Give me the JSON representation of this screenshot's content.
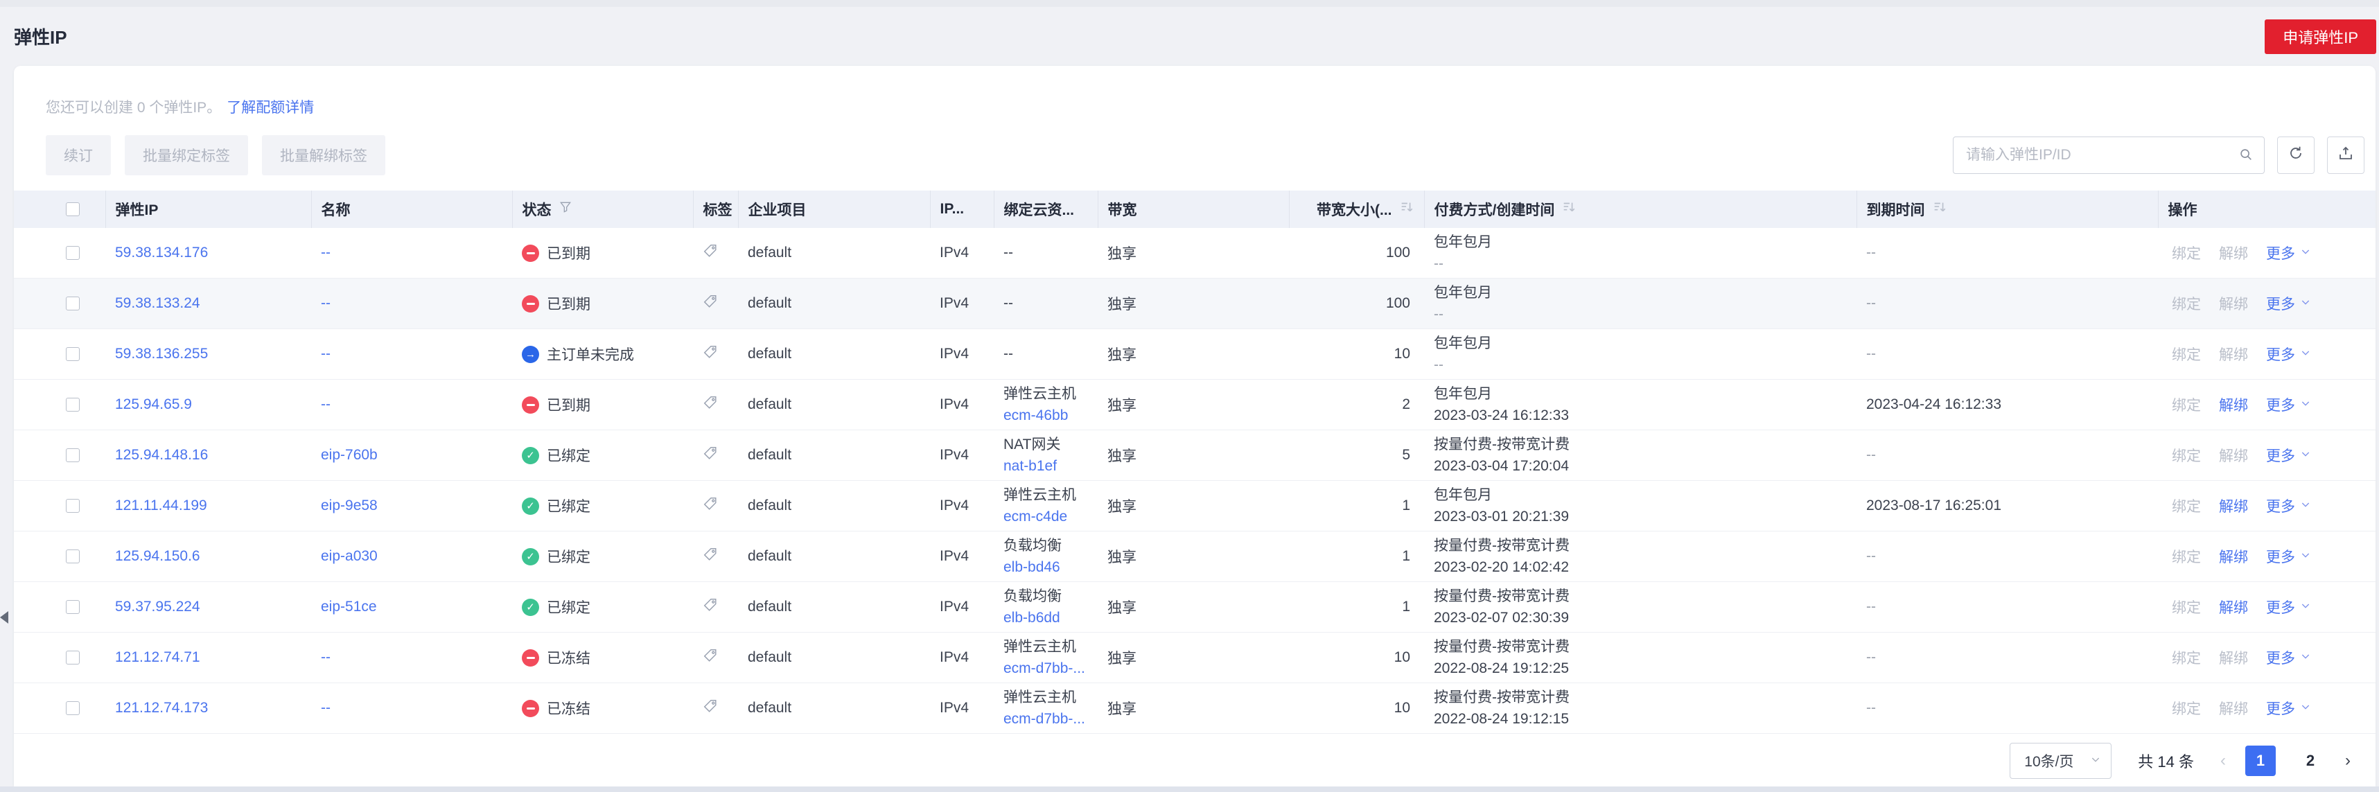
{
  "topbar": {
    "title": "弹性IP",
    "apply_button": "申请弹性IP"
  },
  "quota": {
    "text": "您还可以创建 0 个弹性IP。",
    "link": "了解配额详情"
  },
  "toolbar": {
    "renew": "续订",
    "batch_bind_tags": "批量绑定标签",
    "batch_unbind_tags": "批量解绑标签",
    "search_placeholder": "请输入弹性IP/ID"
  },
  "table": {
    "columns": [
      {
        "key": "ip",
        "label": "弹性IP"
      },
      {
        "key": "name",
        "label": "名称"
      },
      {
        "key": "status",
        "label": "状态",
        "icon": "filter-icon"
      },
      {
        "key": "tags",
        "label": "标签"
      },
      {
        "key": "project",
        "label": "企业项目"
      },
      {
        "key": "ip_version",
        "label": "IP..."
      },
      {
        "key": "resource",
        "label": "绑定云资..."
      },
      {
        "key": "bandwidth_type",
        "label": "带宽"
      },
      {
        "key": "bandwidth_size",
        "label": "带宽大小(...",
        "icon": "sort-icon"
      },
      {
        "key": "billing",
        "label": "付费方式/创建时间",
        "icon": "sort-icon"
      },
      {
        "key": "expire",
        "label": "到期时间",
        "icon": "sort-icon"
      },
      {
        "key": "action",
        "label": "操作"
      }
    ],
    "rows": [
      {
        "ip": "59.38.134.176",
        "name": "--",
        "status": "已到期",
        "status_type": "expired",
        "project": "default",
        "ip_version": "IPv4",
        "resource_type": "",
        "resource_name": "--",
        "bandwidth_type": "独享",
        "bandwidth_size": "100",
        "billing_mode": "包年包月",
        "created": "--",
        "expire": "--",
        "unbind_enabled": false,
        "highlighted": false
      },
      {
        "ip": "59.38.133.24",
        "name": "--",
        "status": "已到期",
        "status_type": "expired",
        "project": "default",
        "ip_version": "IPv4",
        "resource_type": "",
        "resource_name": "--",
        "bandwidth_type": "独享",
        "bandwidth_size": "100",
        "billing_mode": "包年包月",
        "created": "--",
        "expire": "--",
        "unbind_enabled": false,
        "highlighted": true
      },
      {
        "ip": "59.38.136.255",
        "name": "--",
        "status": "主订单未完成",
        "status_type": "pending",
        "project": "default",
        "ip_version": "IPv4",
        "resource_type": "",
        "resource_name": "--",
        "bandwidth_type": "独享",
        "bandwidth_size": "10",
        "billing_mode": "包年包月",
        "created": "--",
        "expire": "--",
        "unbind_enabled": false,
        "highlighted": false
      },
      {
        "ip": "125.94.65.9",
        "name": "--",
        "status": "已到期",
        "status_type": "expired",
        "project": "default",
        "ip_version": "IPv4",
        "resource_type": "弹性云主机",
        "resource_name": "ecm-46bb",
        "bandwidth_type": "独享",
        "bandwidth_size": "2",
        "billing_mode": "包年包月",
        "created": "2023-03-24 16:12:33",
        "expire": "2023-04-24 16:12:33",
        "unbind_enabled": true,
        "highlighted": false
      },
      {
        "ip": "125.94.148.16",
        "name": "eip-760b",
        "status": "已绑定",
        "status_type": "bound",
        "project": "default",
        "ip_version": "IPv4",
        "resource_type": "NAT网关",
        "resource_name": "nat-b1ef",
        "bandwidth_type": "独享",
        "bandwidth_size": "5",
        "billing_mode": "按量付费-按带宽计费",
        "created": "2023-03-04 17:20:04",
        "expire": "--",
        "unbind_enabled": false,
        "highlighted": false
      },
      {
        "ip": "121.11.44.199",
        "name": "eip-9e58",
        "status": "已绑定",
        "status_type": "bound",
        "project": "default",
        "ip_version": "IPv4",
        "resource_type": "弹性云主机",
        "resource_name": "ecm-c4de",
        "bandwidth_type": "独享",
        "bandwidth_size": "1",
        "billing_mode": "包年包月",
        "created": "2023-03-01 20:21:39",
        "expire": "2023-08-17 16:25:01",
        "unbind_enabled": true,
        "highlighted": false
      },
      {
        "ip": "125.94.150.6",
        "name": "eip-a030",
        "status": "已绑定",
        "status_type": "bound",
        "project": "default",
        "ip_version": "IPv4",
        "resource_type": "负载均衡",
        "resource_name": "elb-bd46",
        "bandwidth_type": "独享",
        "bandwidth_size": "1",
        "billing_mode": "按量付费-按带宽计费",
        "created": "2023-02-20 14:02:42",
        "expire": "--",
        "unbind_enabled": true,
        "highlighted": false
      },
      {
        "ip": "59.37.95.224",
        "name": "eip-51ce",
        "status": "已绑定",
        "status_type": "bound",
        "project": "default",
        "ip_version": "IPv4",
        "resource_type": "负载均衡",
        "resource_name": "elb-b6dd",
        "bandwidth_type": "独享",
        "bandwidth_size": "1",
        "billing_mode": "按量付费-按带宽计费",
        "created": "2023-02-07 02:30:39",
        "expire": "--",
        "unbind_enabled": true,
        "highlighted": false
      },
      {
        "ip": "121.12.74.71",
        "name": "--",
        "status": "已冻结",
        "status_type": "frozen",
        "project": "default",
        "ip_version": "IPv4",
        "resource_type": "弹性云主机",
        "resource_name": "ecm-d7bb-...",
        "bandwidth_type": "独享",
        "bandwidth_size": "10",
        "billing_mode": "按量付费-按带宽计费",
        "created": "2022-08-24 19:12:25",
        "expire": "--",
        "unbind_enabled": false,
        "highlighted": false
      },
      {
        "ip": "121.12.74.173",
        "name": "--",
        "status": "已冻结",
        "status_type": "frozen",
        "project": "default",
        "ip_version": "IPv4",
        "resource_type": "弹性云主机",
        "resource_name": "ecm-d7bb-...",
        "bandwidth_type": "独享",
        "bandwidth_size": "10",
        "billing_mode": "按量付费-按带宽计费",
        "created": "2022-08-24 19:12:15",
        "expire": "--",
        "unbind_enabled": false,
        "highlighted": false
      }
    ]
  },
  "row_actions": {
    "bind": "绑定",
    "unbind": "解绑",
    "more": "更多"
  },
  "pagination": {
    "page_size": "10条/页",
    "total": "共 14 条",
    "pages": [
      "1",
      "2"
    ],
    "active_page": "1"
  },
  "status_styles": {
    "expired": {
      "color": "#f24b5b",
      "icon": "minus-circle-icon"
    },
    "frozen": {
      "color": "#f24b5b",
      "icon": "minus-circle-icon"
    },
    "pending": {
      "color": "#2a66e8",
      "icon": "arrow-right-circle-icon"
    },
    "bound": {
      "color": "#3cc391",
      "icon": "check-circle-icon"
    }
  },
  "colors": {
    "primary_button": "#e2202e",
    "link": "#4a74ee",
    "active_page": "#3d6ef2",
    "table_header_bg": "#eef1f8",
    "disabled_text": "#b9bec9"
  },
  "icons": {
    "search": "search-icon",
    "refresh": "refresh-icon",
    "export": "export-icon",
    "filter": "filter-icon",
    "sort": "sort-icon",
    "tag": "tag-icon",
    "chevron_down": "chevron-down-icon",
    "collapse": "collapse-left-icon"
  }
}
